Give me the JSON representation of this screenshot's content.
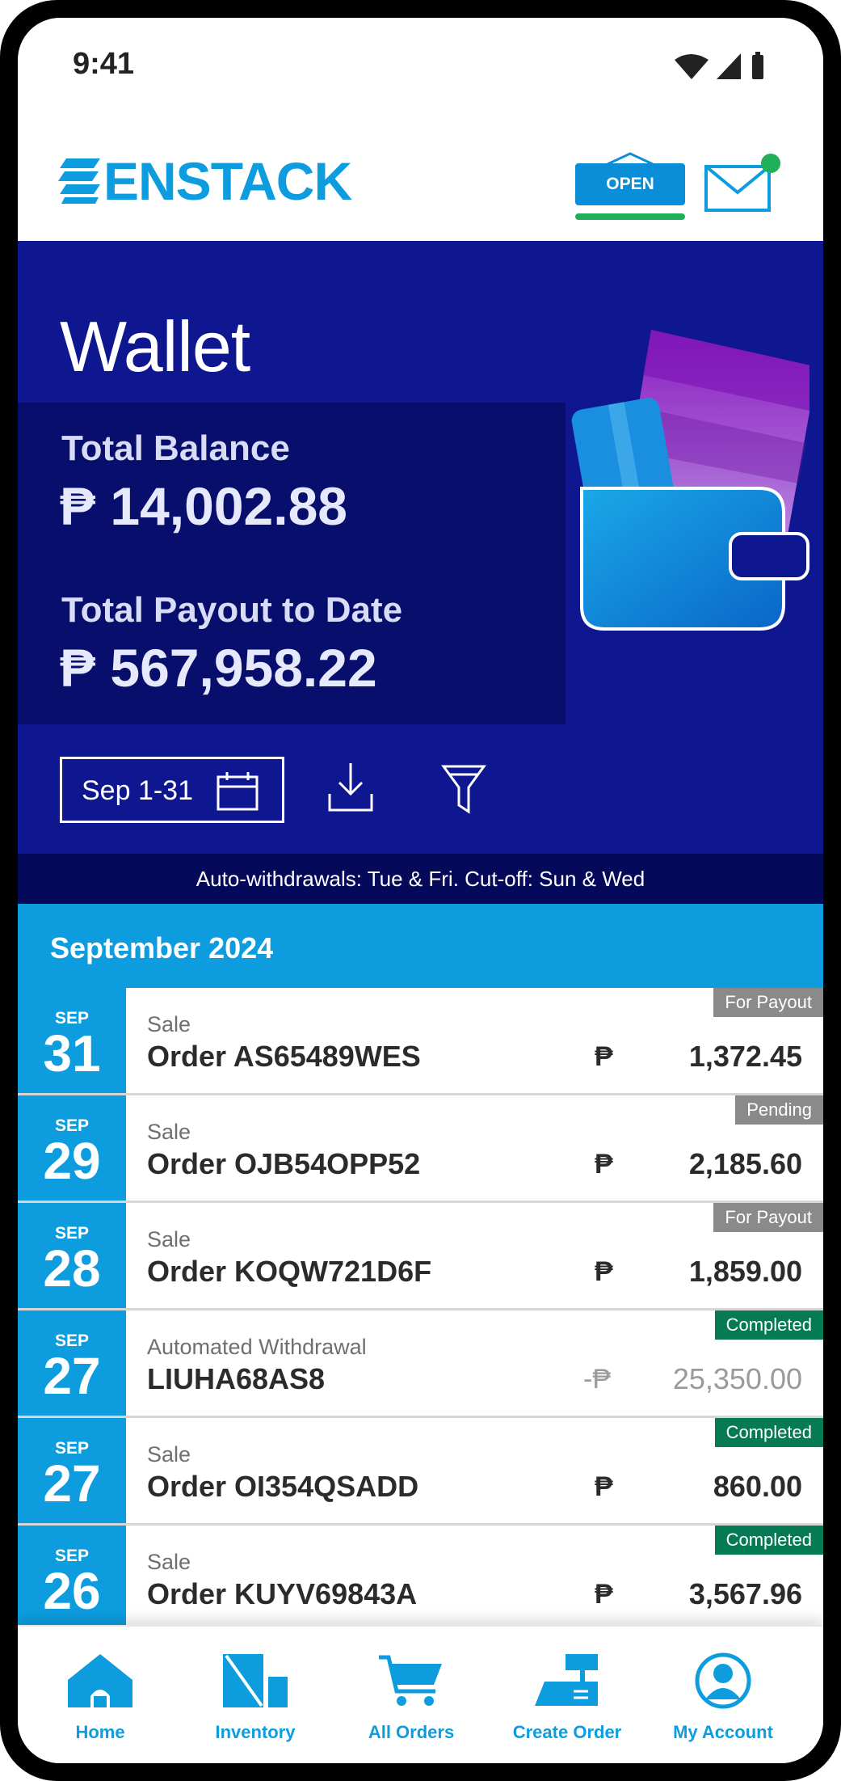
{
  "status_bar": {
    "time": "9:41"
  },
  "header": {
    "brand": "ENSTACK",
    "store_status": "OPEN"
  },
  "wallet": {
    "title": "Wallet",
    "total_balance_label": "Total Balance",
    "total_balance": "₱ 14,002.88",
    "total_payout_label": "Total Payout to Date",
    "total_payout": "₱ 567,958.22",
    "date_range": "Sep 1-31"
  },
  "banner": "Auto-withdrawals: Tue & Fri. Cut-off: Sun & Wed",
  "month_header": "September 2024",
  "transactions": [
    {
      "month": "SEP",
      "day": "31",
      "type": "Sale",
      "ref": "Order AS65489WES",
      "currency": "₱",
      "amount": "1,372.45",
      "status": "For Payout"
    },
    {
      "month": "SEP",
      "day": "29",
      "type": "Sale",
      "ref": "Order OJB54OPP52",
      "currency": "₱",
      "amount": "2,185.60",
      "status": "Pending"
    },
    {
      "month": "SEP",
      "day": "28",
      "type": "Sale",
      "ref": "Order KOQW721D6F",
      "currency": "₱",
      "amount": "1,859.00",
      "status": "For Payout"
    },
    {
      "month": "SEP",
      "day": "27",
      "type": "Automated Withdrawal",
      "ref": "LIUHA68AS8",
      "currency": "-₱",
      "amount": "25,350.00",
      "status": "Completed"
    },
    {
      "month": "SEP",
      "day": "27",
      "type": "Sale",
      "ref": "Order OI354QSADD",
      "currency": "₱",
      "amount": "860.00",
      "status": "Completed"
    },
    {
      "month": "SEP",
      "day": "26",
      "type": "Sale",
      "ref": "Order KUYV69843A",
      "currency": "₱",
      "amount": "3,567.96",
      "status": "Completed"
    }
  ],
  "nav": [
    {
      "label": "Home",
      "icon": "home-icon"
    },
    {
      "label": "Inventory",
      "icon": "inventory-icon"
    },
    {
      "label": "All Orders",
      "icon": "cart-icon"
    },
    {
      "label": "Create Order",
      "icon": "register-icon"
    },
    {
      "label": "My Account",
      "icon": "account-icon"
    }
  ],
  "colors": {
    "brand_blue": "#0d9ddf",
    "hero_navy": "#0f1790",
    "status_green": "#057a55",
    "status_grey": "#8a8a8a"
  }
}
